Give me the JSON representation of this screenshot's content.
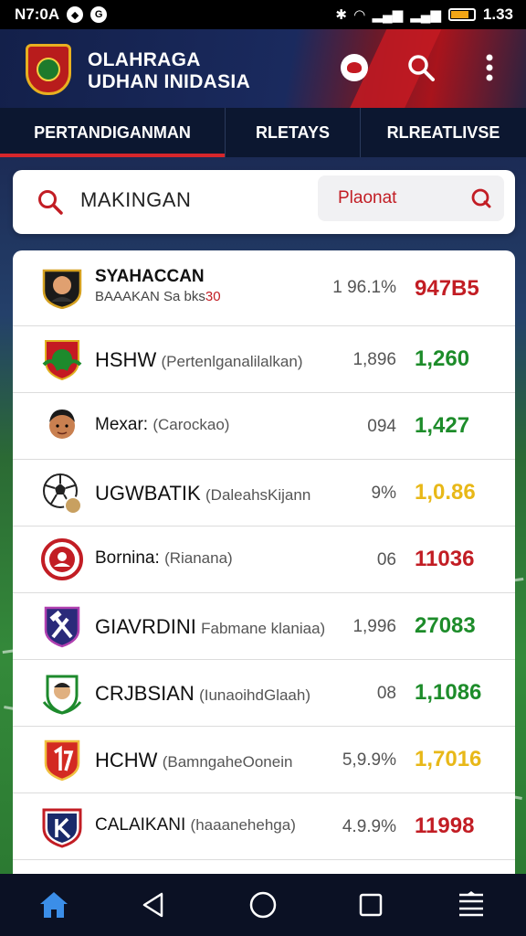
{
  "status_bar": {
    "time": "N7:0A",
    "battery_text": "1.33"
  },
  "header": {
    "title_line1": "OLAHRAGA",
    "title_line2": "UDHAN INIDASIA"
  },
  "tabs": [
    {
      "label": "PERTANDIGANMAN",
      "active": true
    },
    {
      "label": "RLETAYS",
      "active": false
    },
    {
      "label": "RLREATLIVSE",
      "active": false
    }
  ],
  "search": {
    "value": "MAKINGAN",
    "filter_label": "Plaonat"
  },
  "rows": [
    {
      "name_line1": "SYAHACCAN",
      "name_line2": "BAAAKAN Sa bks",
      "name_line2_red": "30",
      "pct": "1 96.1%",
      "value": "947B5",
      "color": "#c21d24"
    },
    {
      "name": "HSHW",
      "sub": "(Pertenlganalilalkan)",
      "pct": "1,896",
      "value": "1,260",
      "color": "#1d8c2a"
    },
    {
      "name": "Mexar:",
      "sub": "(Carockao)",
      "pct": "094",
      "value": "1,427",
      "color": "#1d8c2a"
    },
    {
      "name": "UGWBATIK",
      "sub": "(DaleahsKijann",
      "pct": "9%",
      "value": "1,0.86",
      "color": "#e8b818"
    },
    {
      "name": "Bornina:",
      "sub": "(Rianana)",
      "pct": "06",
      "value": "11036",
      "color": "#c21d24"
    },
    {
      "name": "GIAVRDINI",
      "sub": "Fabmane klaniaa)",
      "pct": "1,996",
      "value": "27083",
      "color": "#1d8c2a"
    },
    {
      "name": "CRJBSIAN",
      "sub": "(IunaoihdGlaah)",
      "pct": "08",
      "value": "1,1086",
      "color": "#1d8c2a"
    },
    {
      "name": "HCHW",
      "sub": "(BamngaheOonein",
      "pct": "5,9.9%",
      "value": "1,7016",
      "color": "#e8b818"
    },
    {
      "name": "CALAIKANI",
      "sub": "(haaanehehga)",
      "pct": "4.9.9%",
      "value": "11998",
      "color": "#c21d24"
    }
  ],
  "icons": [
    "home-icon",
    "back-icon",
    "circle-home-icon",
    "square-recents-icon",
    "menu-lines-icon"
  ]
}
